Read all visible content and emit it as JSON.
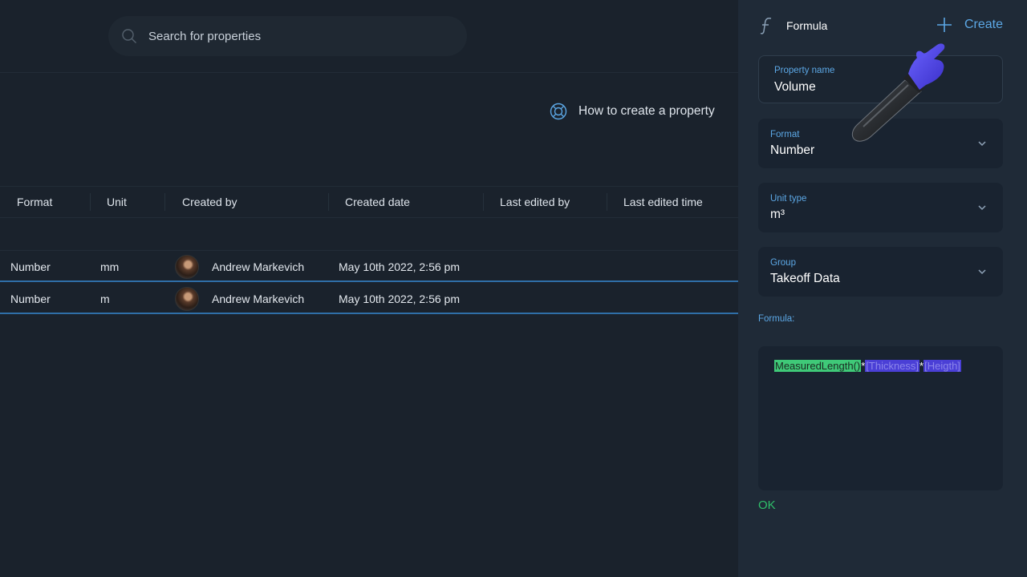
{
  "search": {
    "placeholder": "Search for properties"
  },
  "help_link": {
    "label": "How to create a property"
  },
  "table": {
    "columns": [
      "Format",
      "Unit",
      "Created by",
      "Created date",
      "Last edited by",
      "Last edited time"
    ],
    "rows": [
      {
        "format": "Number",
        "unit": "mm",
        "created_by": "Andrew Markevich",
        "created_date": "May 10th 2022, 2:56 pm"
      },
      {
        "format": "Number",
        "unit": "m",
        "created_by": "Andrew Markevich",
        "created_date": "May 10th 2022, 2:56 pm"
      }
    ]
  },
  "panel": {
    "title": "Formula",
    "create_label": "Create",
    "property_name": {
      "label": "Property name",
      "value": "Volume"
    },
    "format": {
      "label": "Format",
      "value": "Number"
    },
    "unit_type": {
      "label": "Unit type",
      "value": "m³"
    },
    "group": {
      "label": "Group",
      "value": "Takeoff Data"
    },
    "formula_label": "Formula:",
    "formula_tokens": {
      "fn": "MeasuredLength()",
      "op1": "*",
      "var1": "[Thickness]",
      "op2": "*",
      "var2": "[Heigth]"
    },
    "ok_label": "OK"
  },
  "colors": {
    "background": "#1a222c",
    "panel": "#1f2a37",
    "accent_blue": "#5ca8e6",
    "ok_green": "#2fbf6a",
    "function_token": "#3fc978",
    "variable_token": "#4a3fd6",
    "row_highlight": "#2f6fa8"
  },
  "icons": [
    "search-icon",
    "lifebuoy-icon",
    "formula-icon",
    "plus-icon",
    "chevron-down-icon",
    "pointing-hand-cursor-icon"
  ]
}
